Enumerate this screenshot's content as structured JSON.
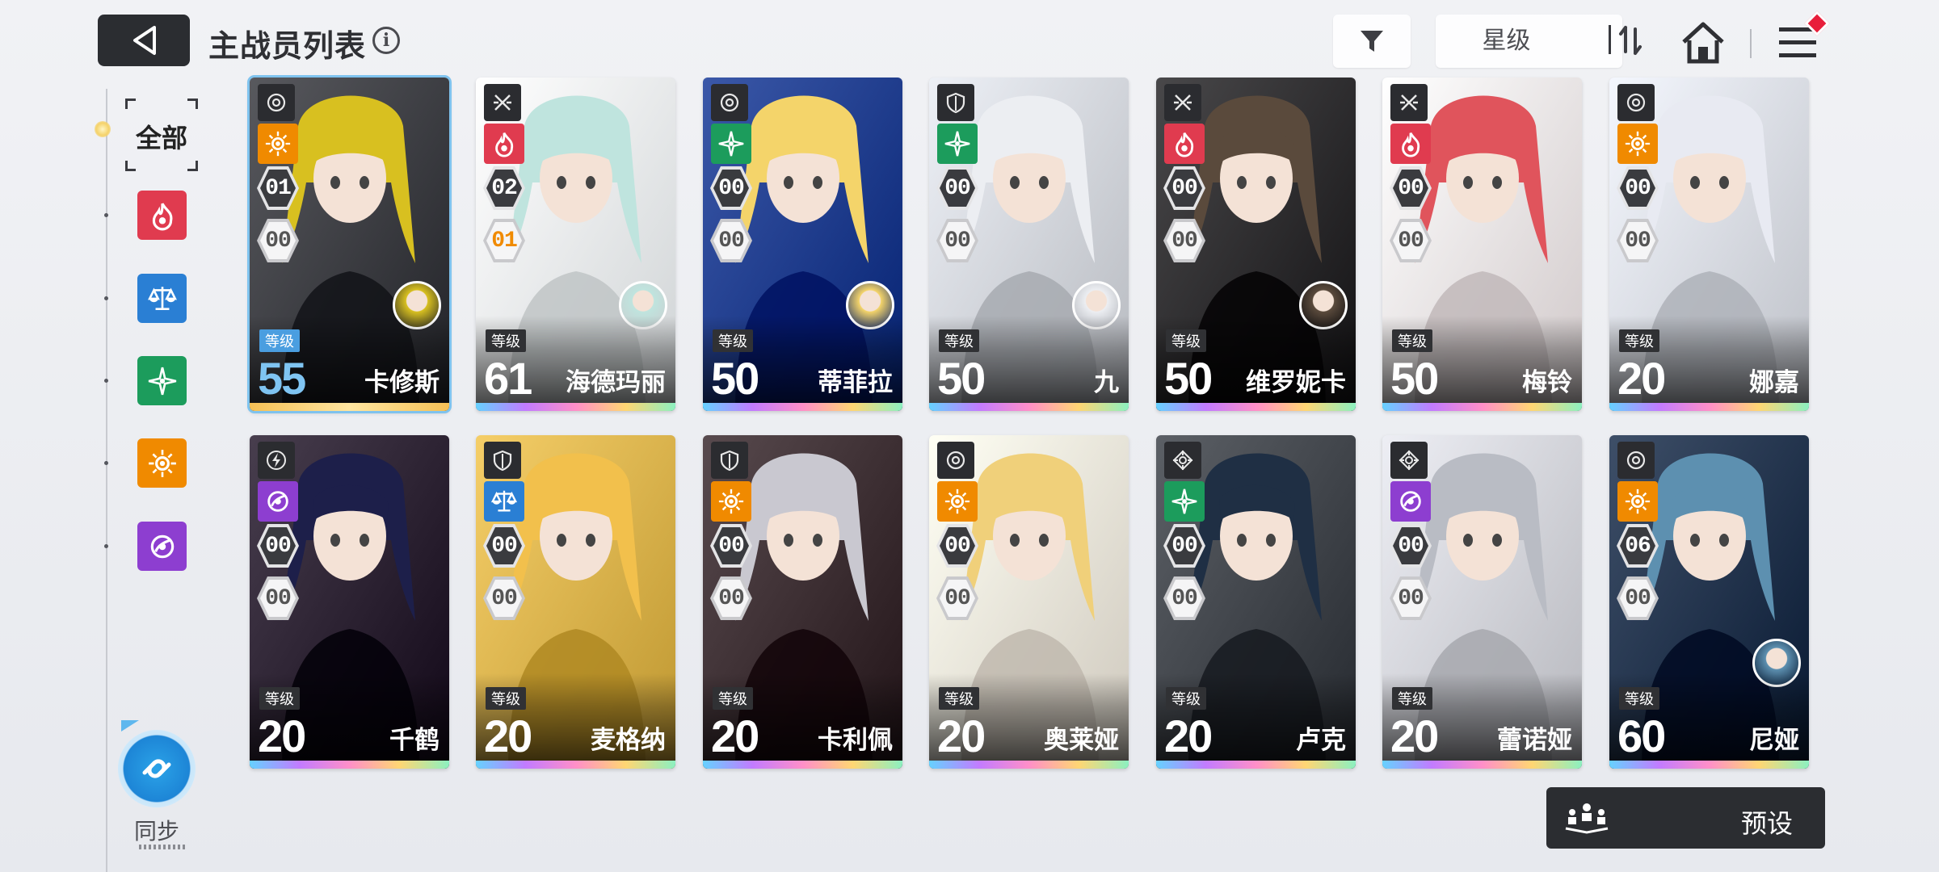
{
  "header": {
    "title": "主战员列表",
    "info_icon": "i",
    "sort_label": "星级",
    "icons": [
      "back-arrow-icon",
      "filter-funnel-icon",
      "sort-toggle-icon",
      "home-icon",
      "hamburger-menu-icon"
    ]
  },
  "filters": {
    "all_label": "全部",
    "items": [
      {
        "name": "burn",
        "color": "#e03b4f"
      },
      {
        "name": "balance",
        "color": "#2a7fd4"
      },
      {
        "name": "wind",
        "color": "#1c9c5c"
      },
      {
        "name": "radiant",
        "color": "#f08a00"
      },
      {
        "name": "void",
        "color": "#8d3ed0"
      }
    ]
  },
  "sync": {
    "label": "同步"
  },
  "preset": {
    "label": "预设"
  },
  "level_tag": "等级",
  "cards": [
    {
      "name": "卡修斯",
      "level": "55",
      "rank": "01",
      "sub": "00",
      "role": "target",
      "element": "radiant",
      "elem_color": "#f08a00",
      "bg": "#3a3b40",
      "hair": "#d8c020",
      "selected": true,
      "companion": true
    },
    {
      "name": "海德玛丽",
      "level": "61",
      "rank": "02",
      "sub": "01",
      "role": "blades",
      "element": "burn",
      "elem_color": "#e03b4f",
      "bg": "#e8ecee",
      "hair": "#bfe4de",
      "selected": false,
      "companion": true
    },
    {
      "name": "蒂菲拉",
      "level": "50",
      "rank": "00",
      "sub": "00",
      "role": "target",
      "element": "wind",
      "elem_color": "#1c9c5c",
      "bg": "#1d3a8a",
      "hair": "#f4d46a",
      "selected": false,
      "companion": true
    },
    {
      "name": "九",
      "level": "50",
      "rank": "00",
      "sub": "00",
      "role": "shield",
      "element": "wind",
      "elem_color": "#1c9c5c",
      "bg": "#cfd2d8",
      "hair": "#eceef2",
      "selected": false,
      "companion": true
    },
    {
      "name": "维罗妮卡",
      "level": "50",
      "rank": "00",
      "sub": "00",
      "role": "blades",
      "element": "burn",
      "elem_color": "#e03b4f",
      "bg": "#2b2a2c",
      "hair": "#5a4a3c",
      "selected": false,
      "companion": true
    },
    {
      "name": "梅铃",
      "level": "50",
      "rank": "00",
      "sub": "00",
      "role": "blades",
      "element": "burn",
      "elem_color": "#e03b4f",
      "bg": "#e9e1e2",
      "hair": "#e0545c",
      "selected": false,
      "companion": false
    },
    {
      "name": "娜嘉",
      "level": "20",
      "rank": "00",
      "sub": "00",
      "role": "target",
      "element": "radiant",
      "elem_color": "#f08a00",
      "bg": "#d6d9e0",
      "hair": "#e8eaf2",
      "selected": false,
      "companion": false
    },
    {
      "name": "千鹤",
      "level": "20",
      "rank": "00",
      "sub": "00",
      "role": "bolt",
      "element": "void",
      "elem_color": "#8d3ed0",
      "bg": "#2a2030",
      "hair": "#1d1f4a",
      "selected": false,
      "companion": false
    },
    {
      "name": "麦格纳",
      "level": "20",
      "rank": "00",
      "sub": "00",
      "role": "shield",
      "element": "balance",
      "elem_color": "#2a7fd4",
      "bg": "#d7b04a",
      "hair": "#f2c04c",
      "selected": false,
      "companion": false
    },
    {
      "name": "卡利佩",
      "level": "20",
      "rank": "00",
      "sub": "00",
      "role": "shield",
      "element": "radiant",
      "elem_color": "#f08a00",
      "bg": "#3a2c30",
      "hair": "#c9c8d0",
      "selected": false,
      "companion": false
    },
    {
      "name": "奥莱娅",
      "level": "20",
      "rank": "00",
      "sub": "00",
      "role": "target",
      "element": "radiant",
      "elem_color": "#f08a00",
      "bg": "#e7e1d6",
      "hair": "#f0d07a",
      "selected": false,
      "companion": false
    },
    {
      "name": "卢克",
      "level": "20",
      "rank": "00",
      "sub": "00",
      "role": "crosshair",
      "element": "wind",
      "elem_color": "#1c9c5c",
      "bg": "#3e4248",
      "hair": "#1f2f44",
      "selected": false,
      "companion": false
    },
    {
      "name": "蕾诺娅",
      "level": "20",
      "rank": "00",
      "sub": "00",
      "role": "crosshair",
      "element": "void",
      "elem_color": "#8d3ed0",
      "bg": "#cfd0d6",
      "hair": "#b9bcc4",
      "selected": false,
      "companion": false
    },
    {
      "name": "尼娅",
      "level": "60",
      "rank": "06",
      "sub": "00",
      "role": "target",
      "element": "radiant",
      "elem_color": "#f08a00",
      "bg": "#20314a",
      "hair": "#5d90b0",
      "selected": false,
      "companion": true
    }
  ]
}
